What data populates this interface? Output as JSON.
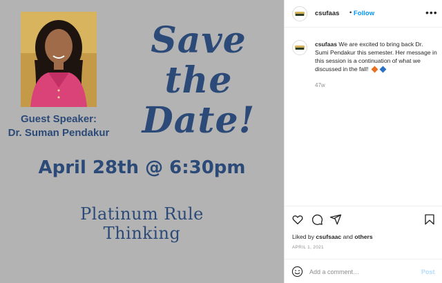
{
  "post_image": {
    "headline": "Save the Date!",
    "guest_label": "Guest Speaker:",
    "guest_name": "Dr. Suman Pendakur",
    "event_datetime": "April 28th @ 6:30pm",
    "topic_line1": "Platinum Rule",
    "topic_line2": "Thinking"
  },
  "header": {
    "username": "csufaas",
    "separator": "•",
    "follow_label": "Follow",
    "more_label": "•••"
  },
  "caption": {
    "username": "csufaas",
    "text": "We are excited to bring back Dr. Sumi Pendakur this semester. Her message in this session is a continuation of what we discussed in the fall!",
    "emoji_colors": [
      "#e8711f",
      "#2a72c4"
    ],
    "time_ago": "47w"
  },
  "actions": {
    "icons": [
      "heart-icon",
      "comment-icon",
      "share-icon",
      "bookmark-icon"
    ]
  },
  "likes": {
    "prefix": "Liked by",
    "user": "csufsaac",
    "conjunction": "and",
    "others": "others"
  },
  "post_date": "APRIL 1, 2021",
  "comment": {
    "placeholder": "Add a comment…",
    "post_label": "Post"
  },
  "colors": {
    "accent": "#0095f6",
    "flyer_text": "#2c4a78",
    "flyer_bg": "#b3b3b3"
  }
}
